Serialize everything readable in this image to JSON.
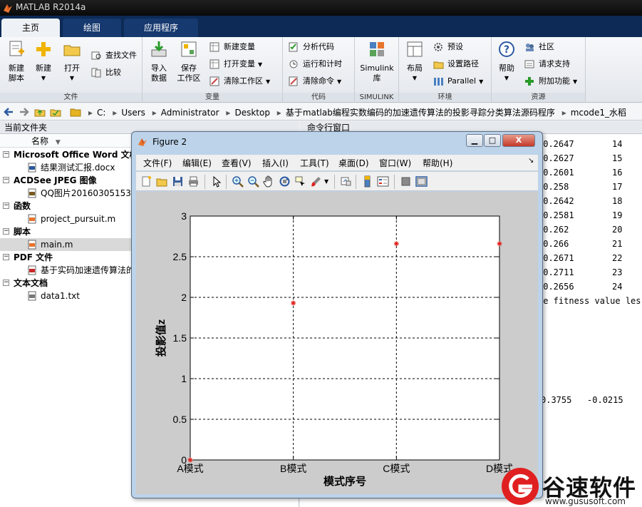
{
  "app": {
    "title": "MATLAB R2014a"
  },
  "tabs": [
    {
      "label": "主页",
      "active": true
    },
    {
      "label": "绘图",
      "active": false
    },
    {
      "label": "应用程序",
      "active": false
    }
  ],
  "ribbon": {
    "file": {
      "label": "文件",
      "new_script": "新建\n脚本",
      "new": "新建",
      "open": "打开",
      "find_files": "查找文件",
      "compare": "比较"
    },
    "variable": {
      "label": "变量",
      "import": "导入\n数据",
      "save_ws": "保存\n工作区",
      "new_var": "新建变量",
      "open_var": "打开变量",
      "clear_ws": "清除工作区"
    },
    "code": {
      "label": "代码",
      "analyze": "分析代码",
      "run_time": "运行和计时",
      "clear_cmd": "清除命令"
    },
    "simulink": {
      "label": "SIMULINK",
      "lib": "Simulink\n库"
    },
    "env": {
      "label": "环境",
      "layout": "布局",
      "prefs": "预设",
      "set_path": "设置路径",
      "parallel": "Parallel"
    },
    "resources": {
      "label": "资源",
      "help": "帮助",
      "community": "社区",
      "support": "请求支持",
      "addons": "附加功能"
    }
  },
  "address": {
    "crumbs": [
      "C:",
      "Users",
      "Administrator",
      "Desktop",
      "基于matlab编程实数编码的加速遗传算法的投影寻踪分类算法源码程序",
      "mcode1_水稻"
    ]
  },
  "current_folder": {
    "title": "当前文件夹",
    "col_name": "名称",
    "sort_icon": "▼",
    "rows": [
      {
        "type": "header",
        "text": "Microsoft Office Word 文档"
      },
      {
        "type": "file",
        "text": "结果测试汇报.docx",
        "icon": "word"
      },
      {
        "type": "header",
        "text": "ACDSee JPEG 图像"
      },
      {
        "type": "file",
        "text": "QQ图片201603051538",
        "icon": "jpeg"
      },
      {
        "type": "header",
        "text": "函数"
      },
      {
        "type": "file",
        "text": "project_pursuit.m",
        "icon": "func"
      },
      {
        "type": "header",
        "text": "脚本"
      },
      {
        "type": "file",
        "text": "main.m",
        "icon": "script",
        "selected": true
      },
      {
        "type": "header",
        "text": "PDF 文件"
      },
      {
        "type": "file",
        "text": "基于实码加速遗传算法的",
        "icon": "pdf"
      },
      {
        "type": "header",
        "text": "文本文档"
      },
      {
        "type": "file",
        "text": "data1.txt",
        "icon": "txt"
      }
    ],
    "toggle_glyph": "−"
  },
  "command_window": {
    "title": "命令行窗口",
    "lines": [
      {
        "a": "-0.2647",
        "b": "14"
      },
      {
        "a": "-0.2627",
        "b": "15"
      },
      {
        "a": "-0.2601",
        "b": "16"
      },
      {
        "a": "-0.258",
        "b": "17"
      },
      {
        "a": "-0.2642",
        "b": "18"
      },
      {
        "a": "-0.2581",
        "b": "19"
      },
      {
        "a": "-0.262",
        "b": "20"
      },
      {
        "a": "-0.266",
        "b": "21"
      },
      {
        "a": "-0.2671",
        "b": "22"
      },
      {
        "a": "-0.2711",
        "b": "23"
      },
      {
        "a": "-0.2656",
        "b": "24"
      }
    ],
    "msg": "he fitness value les",
    "bottom": "0.3755   -0.0215"
  },
  "figure": {
    "title": "Figure 2",
    "btn_min": "▁",
    "btn_max": "□",
    "btn_close": "X",
    "menu": [
      "文件(F)",
      "编辑(E)",
      "查看(V)",
      "插入(I)",
      "工具(T)",
      "桌面(D)",
      "窗口(W)",
      "帮助(H)"
    ],
    "menu_arrow": "↘"
  },
  "chart_data": {
    "type": "scatter",
    "categories": [
      "A模式",
      "B模式",
      "C模式",
      "D模式"
    ],
    "x": [
      1,
      2,
      3,
      4
    ],
    "y": [
      0,
      1.93,
      2.66,
      2.66
    ],
    "xlabel": "模式序号",
    "ylabel": "投影值z",
    "ylim": [
      0,
      3
    ],
    "yticks": [
      "0",
      "0.5",
      "1",
      "1.5",
      "2",
      "2.5",
      "3"
    ],
    "grid": true,
    "marker": "*",
    "marker_color": "#e0201b"
  },
  "watermark": {
    "brand": "谷速软件",
    "url": "www.gususoft.com",
    "color": "#e02020"
  }
}
